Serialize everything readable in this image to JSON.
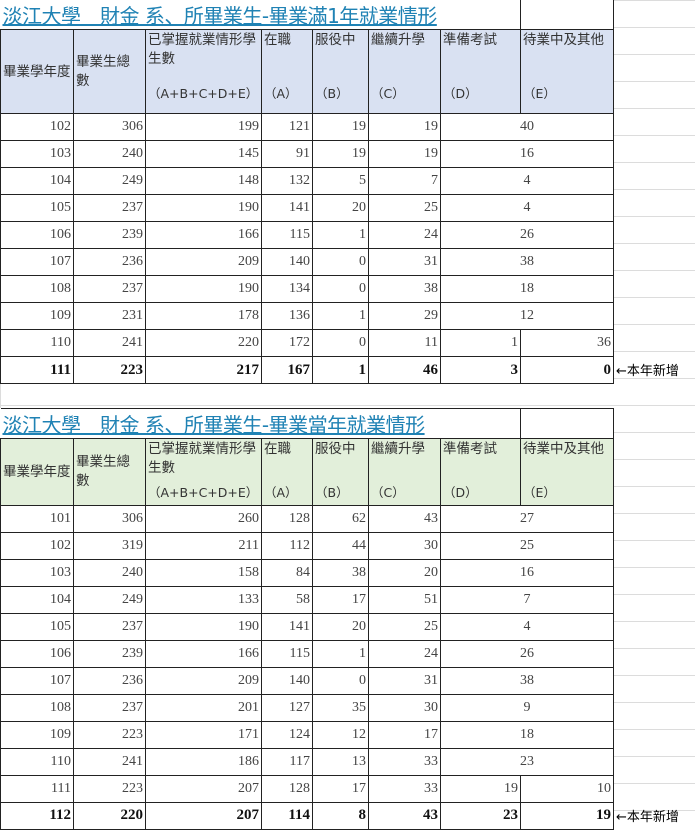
{
  "table1": {
    "title": "淡江大學＿財金 系、所畢業生-畢業滿1年就業情形",
    "headers": [
      "畢業學年度",
      "畢業生總數",
      "已掌握就業情形學生數",
      "在職",
      "服役中",
      "繼續升學",
      "準備考試",
      "待業中及其他"
    ],
    "subheaders": [
      "（A+B+C+D+E）",
      "（A）",
      "（B）",
      "（C）",
      "（D）",
      "（E）"
    ],
    "rows_merged": [
      [
        "102",
        "306",
        "199",
        "121",
        "19",
        "19",
        "40"
      ],
      [
        "103",
        "240",
        "145",
        "91",
        "19",
        "19",
        "16"
      ],
      [
        "104",
        "249",
        "148",
        "132",
        "5",
        "7",
        "4"
      ],
      [
        "105",
        "237",
        "190",
        "141",
        "20",
        "25",
        "4"
      ],
      [
        "106",
        "239",
        "166",
        "115",
        "1",
        "24",
        "26"
      ],
      [
        "107",
        "236",
        "209",
        "140",
        "0",
        "31",
        "38"
      ],
      [
        "108",
        "237",
        "190",
        "134",
        "0",
        "38",
        "18"
      ],
      [
        "109",
        "231",
        "178",
        "136",
        "1",
        "29",
        "12"
      ]
    ],
    "rows_full": [
      [
        "110",
        "241",
        "220",
        "172",
        "0",
        "11",
        "1",
        "36"
      ],
      [
        "111",
        "223",
        "217",
        "167",
        "1",
        "46",
        "3",
        "0"
      ]
    ],
    "note": "←本年新增"
  },
  "table2": {
    "title": "淡江大學＿財金 系、所畢業生-畢業當年就業情形",
    "headers": [
      "畢業學年度",
      "畢業生總數",
      "已掌握就業情形學生數",
      "在職",
      "服役中",
      "繼續升學",
      "準備考試",
      "待業中及其他"
    ],
    "subheaders": [
      "（A+B+C+D+E）",
      "（A）",
      "（B）",
      "（C）",
      "（D）",
      "（E）"
    ],
    "rows_merged": [
      [
        "101",
        "306",
        "260",
        "128",
        "62",
        "43",
        "27"
      ],
      [
        "102",
        "319",
        "211",
        "112",
        "44",
        "30",
        "25"
      ],
      [
        "103",
        "240",
        "158",
        "84",
        "38",
        "20",
        "16"
      ],
      [
        "104",
        "249",
        "133",
        "58",
        "17",
        "51",
        "7"
      ],
      [
        "105",
        "237",
        "190",
        "141",
        "20",
        "25",
        "4"
      ],
      [
        "106",
        "239",
        "166",
        "115",
        "1",
        "24",
        "26"
      ],
      [
        "107",
        "236",
        "209",
        "140",
        "0",
        "31",
        "38"
      ],
      [
        "108",
        "237",
        "201",
        "127",
        "35",
        "30",
        "9"
      ],
      [
        "109",
        "223",
        "171",
        "124",
        "12",
        "17",
        "18"
      ],
      [
        "110",
        "241",
        "186",
        "117",
        "13",
        "33",
        "23"
      ]
    ],
    "rows_full": [
      [
        "111",
        "223",
        "207",
        "128",
        "17",
        "33",
        "19",
        "10"
      ],
      [
        "112",
        "220",
        "207",
        "114",
        "8",
        "43",
        "23",
        "19"
      ]
    ],
    "note": "←本年新增"
  }
}
